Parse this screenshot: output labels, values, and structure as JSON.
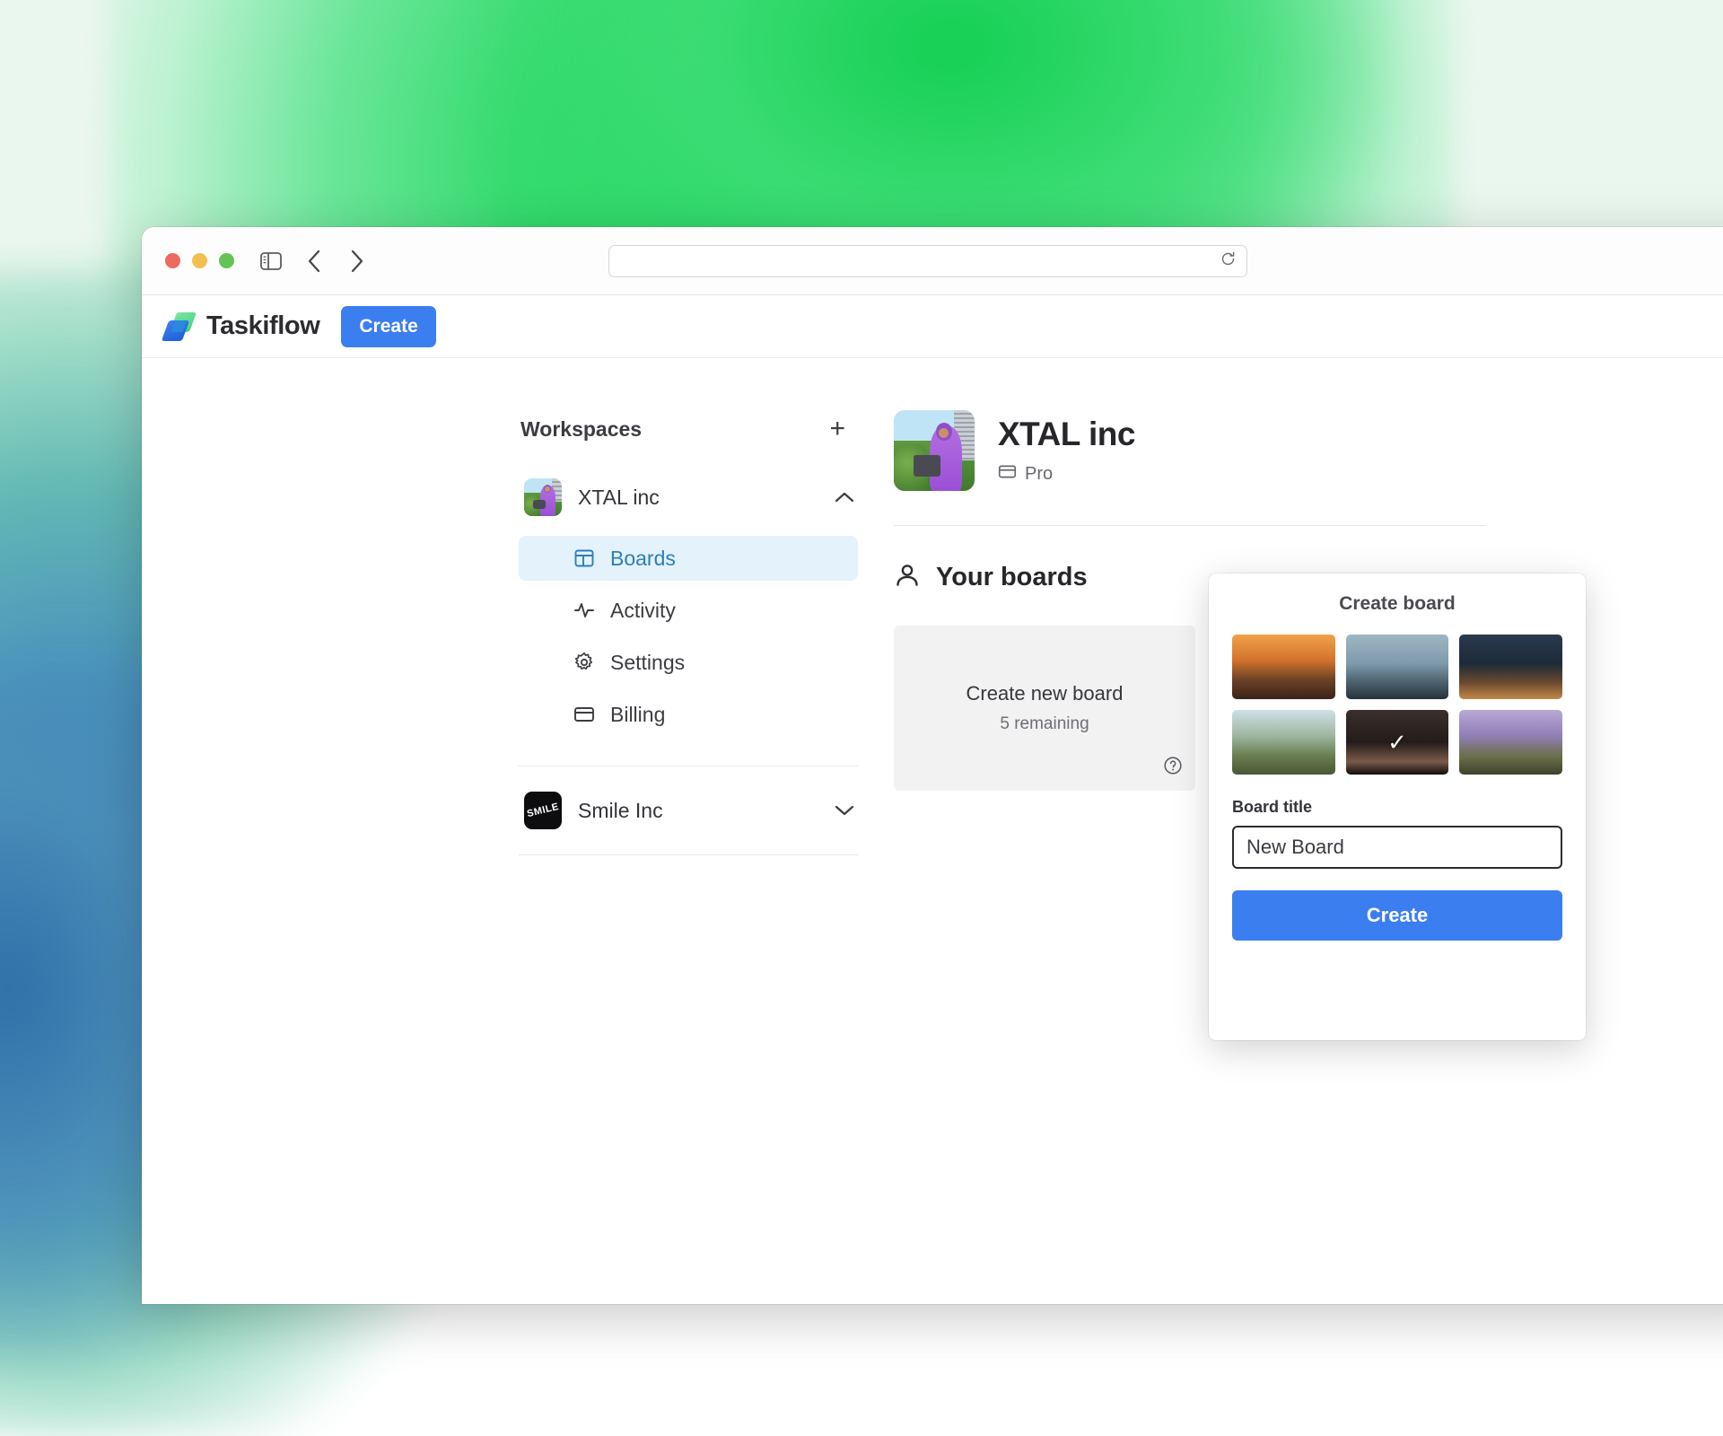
{
  "browser": {
    "traffic_lights": [
      "close",
      "minimize",
      "zoom"
    ],
    "sidebar_toggle_icon": "sidebar-icon",
    "back_icon": "chevron-left-icon",
    "forward_icon": "chevron-right-icon",
    "url_value": "",
    "url_placeholder": "",
    "reload_icon": "reload-icon"
  },
  "app_header": {
    "brand": "Taskiflow",
    "logo_icon": "taskiflow-logo-icon",
    "create_label": "Create"
  },
  "sidebar": {
    "heading": "Workspaces",
    "add_icon": "plus-icon",
    "workspaces": [
      {
        "name": "XTAL inc",
        "avatar_icon": "xtal-inc-avatar",
        "expanded": true,
        "chevron_icon": "chevron-up-icon"
      },
      {
        "name": "Smile Inc",
        "avatar_icon": "smile-inc-avatar",
        "avatar_text": "SMILE",
        "expanded": false,
        "chevron_icon": "chevron-down-icon"
      }
    ],
    "nav_items": [
      {
        "label": "Boards",
        "icon": "boards-icon",
        "active": true
      },
      {
        "label": "Activity",
        "icon": "activity-icon",
        "active": false
      },
      {
        "label": "Settings",
        "icon": "gear-icon",
        "active": false
      },
      {
        "label": "Billing",
        "icon": "credit-card-icon",
        "active": false
      }
    ]
  },
  "main": {
    "workspace_title": "XTAL inc",
    "plan_badge": "Pro",
    "plan_icon": "credit-card-icon",
    "avatar_icon": "xtal-inc-avatar",
    "section_title": "Your boards",
    "section_icon": "user-icon",
    "board_card": {
      "title": "Create new board",
      "subtitle": "5 remaining",
      "help_icon": "help-circle-icon"
    }
  },
  "popover": {
    "title": "Create board",
    "thumbnails": [
      {
        "name": "sunset-hill-thumb",
        "selected": false
      },
      {
        "name": "seaside-cliff-thumb",
        "selected": false
      },
      {
        "name": "night-road-thumb",
        "selected": false
      },
      {
        "name": "highway-curve-thumb",
        "selected": false
      },
      {
        "name": "autumn-tree-thumb",
        "selected": false
      },
      {
        "name": "dark-bird-thumb",
        "selected": true
      },
      {
        "name": "lavender-field-thumb",
        "selected": false
      }
    ],
    "selected_check_icon": "check-icon",
    "field_label": "Board title",
    "field_value": "New Board",
    "field_placeholder": "Board title",
    "submit_label": "Create"
  },
  "colors": {
    "accent_blue": "#3b7ef0",
    "active_nav_bg": "#e4f2fb",
    "active_nav_text": "#2b7fb8",
    "wallpaper_green": "#1fd65f",
    "wallpaper_teal": "#3a7fb5"
  }
}
